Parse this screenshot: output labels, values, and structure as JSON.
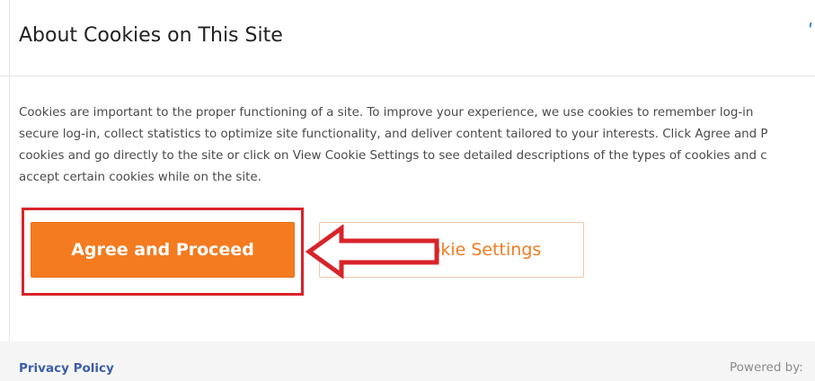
{
  "dialog": {
    "title": "About Cookies on This Site",
    "close_glyph": "ʹ",
    "body_lines": [
      "Cookies are important to the proper functioning of a site. To improve your experience, we use cookies to remember log-in",
      "secure log-in, collect statistics to optimize site functionality, and deliver content tailored to your interests. Click Agree and P",
      "cookies and go directly to the site or click on View Cookie Settings to see detailed descriptions of the types of cookies and c",
      "accept certain cookies while on the site."
    ],
    "agree_label": "Agree and Proceed",
    "settings_label": "View Cookie Settings"
  },
  "footer": {
    "privacy_label": "Privacy Policy",
    "powered_by": "Powered by:"
  },
  "colors": {
    "accent": "#f47b20",
    "highlight": "#d8232a",
    "link": "#3b5ea8"
  },
  "icons": {
    "annotation_arrow": "left-arrow-icon"
  }
}
